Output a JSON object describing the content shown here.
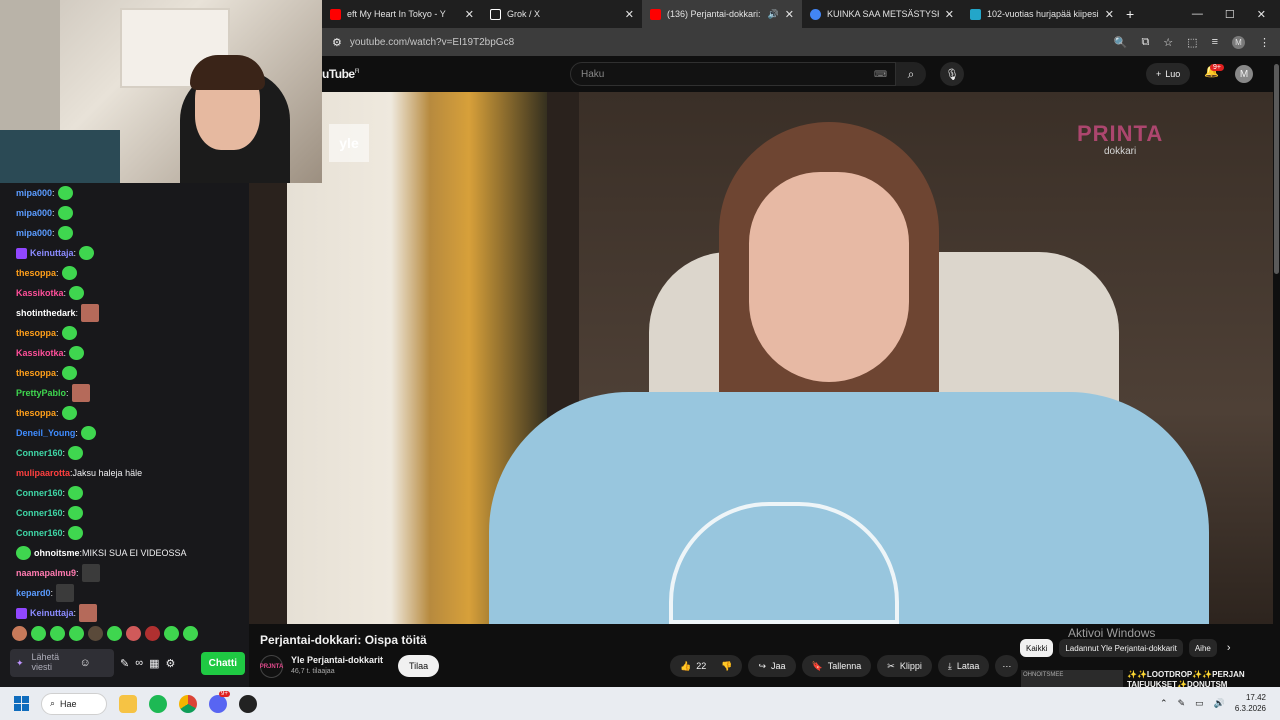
{
  "browser": {
    "tabs": [
      {
        "title": "eft My Heart In Tokyo - Y",
        "color": "#ff0000"
      },
      {
        "title": "Grok / X",
        "color": "#ffffff"
      },
      {
        "title": "(136) Perjantai-dokkari: Oisp",
        "color": "#ff0000"
      },
      {
        "title": "KUINKA SAA METSÄSTYSKORTI",
        "color": "#4285f4"
      },
      {
        "title": "102-vuotias hurjapää kiipesi m",
        "color": "#23a6c9"
      }
    ],
    "url": "youtube.com/watch?v=EI19T2bpGc8",
    "profile_initial": "M"
  },
  "youtube": {
    "logo": "uTube",
    "logo_region": "FI",
    "search_placeholder": "Haku",
    "create_label": "Luo",
    "notif_count": "9+",
    "avatar_initial": "M",
    "video": {
      "title": "Perjantai-dokkari: Oispa töitä",
      "overlay_logo": "yle",
      "overlay_brand_big": "PRINTA",
      "overlay_brand_small": "dokkari"
    },
    "channel": {
      "name": "Yle Perjantai-dokkarit",
      "subs": "46,7 t. tilaajaa",
      "avatar_text": "PRJNTA"
    },
    "subscribe_label": "Tilaa",
    "actions": {
      "likes": "22",
      "share": "Jaa",
      "save": "Tallenna",
      "clip": "Klippi",
      "download": "Lataa"
    },
    "chips": [
      "Kaikki",
      "Ladannut Yle Perjantai-dokkarit",
      "Aihe"
    ],
    "windows_notice": "Aktivoi Windows",
    "recommendation": {
      "title": "✨✨LOOTDROP✨✨PERJAN TAIFUUKSET✨DONUTSM",
      "thumb_text": "OHNOITSMEE"
    }
  },
  "chat": {
    "messages": [
      {
        "user": "mipa000",
        "color": "#5a9bff",
        "text": "",
        "emote": "green"
      },
      {
        "user": "mipa000",
        "color": "#5a9bff",
        "text": "",
        "emote": "green"
      },
      {
        "user": "mipa000",
        "color": "#5a9bff",
        "text": "",
        "emote": "green"
      },
      {
        "user": "Keinuttaja",
        "color": "#8b8bff",
        "text": "",
        "emote": "green",
        "badge": true
      },
      {
        "user": "thesoppa",
        "color": "#ff9f1a",
        "text": "",
        "emote": "green"
      },
      {
        "user": "Kassikotka",
        "color": "#ff4f9a",
        "text": "",
        "emote": "green"
      },
      {
        "user": "shotinthedark",
        "color": "#ffffff",
        "text": "",
        "emote": "img"
      },
      {
        "user": "thesoppa",
        "color": "#ff9f1a",
        "text": "",
        "emote": "green"
      },
      {
        "user": "Kassikotka",
        "color": "#ff4f9a",
        "text": "",
        "emote": "green"
      },
      {
        "user": "thesoppa",
        "color": "#ff9f1a",
        "text": "",
        "emote": "green"
      },
      {
        "user": "PrettyPablo",
        "color": "#3fd64f",
        "text": "",
        "emote": "img"
      },
      {
        "user": "thesoppa",
        "color": "#ff9f1a",
        "text": "",
        "emote": "green"
      },
      {
        "user": "Deneil_Young",
        "color": "#3f8cff",
        "text": "",
        "emote": "green"
      },
      {
        "user": "Conner160",
        "color": "#3fd6a6",
        "text": "",
        "emote": "green"
      },
      {
        "user": "mulipaarotta",
        "color": "#ff3f3f",
        "text": " Jaksu haleja häle",
        "emote": ""
      },
      {
        "user": "Conner160",
        "color": "#3fd6a6",
        "text": "",
        "emote": "green"
      },
      {
        "user": "Conner160",
        "color": "#3fd6a6",
        "text": "",
        "emote": "green"
      },
      {
        "user": "Conner160",
        "color": "#3fd6a6",
        "text": "",
        "emote": "green"
      },
      {
        "user": "ohnoitsme",
        "color": "#ffffff",
        "text": " MIKSI SUA EI VIDEOSSA",
        "emote": "",
        "badge_emote": true
      },
      {
        "user": "naamapalmu9",
        "color": "#ff7ab0",
        "text": "",
        "emote": "dark"
      },
      {
        "user": "kepard0",
        "color": "#5a9bff",
        "text": "",
        "emote": "dark"
      },
      {
        "user": "Keinuttaja",
        "color": "#8b8bff",
        "text": "",
        "emote": "img",
        "badge": true
      }
    ],
    "input_placeholder": "Lähetä viesti",
    "send_label": "Chatti"
  },
  "taskbar": {
    "search_label": "Hae",
    "time": "17.42",
    "date": "6.3.2026",
    "discord_badge": "9+"
  }
}
